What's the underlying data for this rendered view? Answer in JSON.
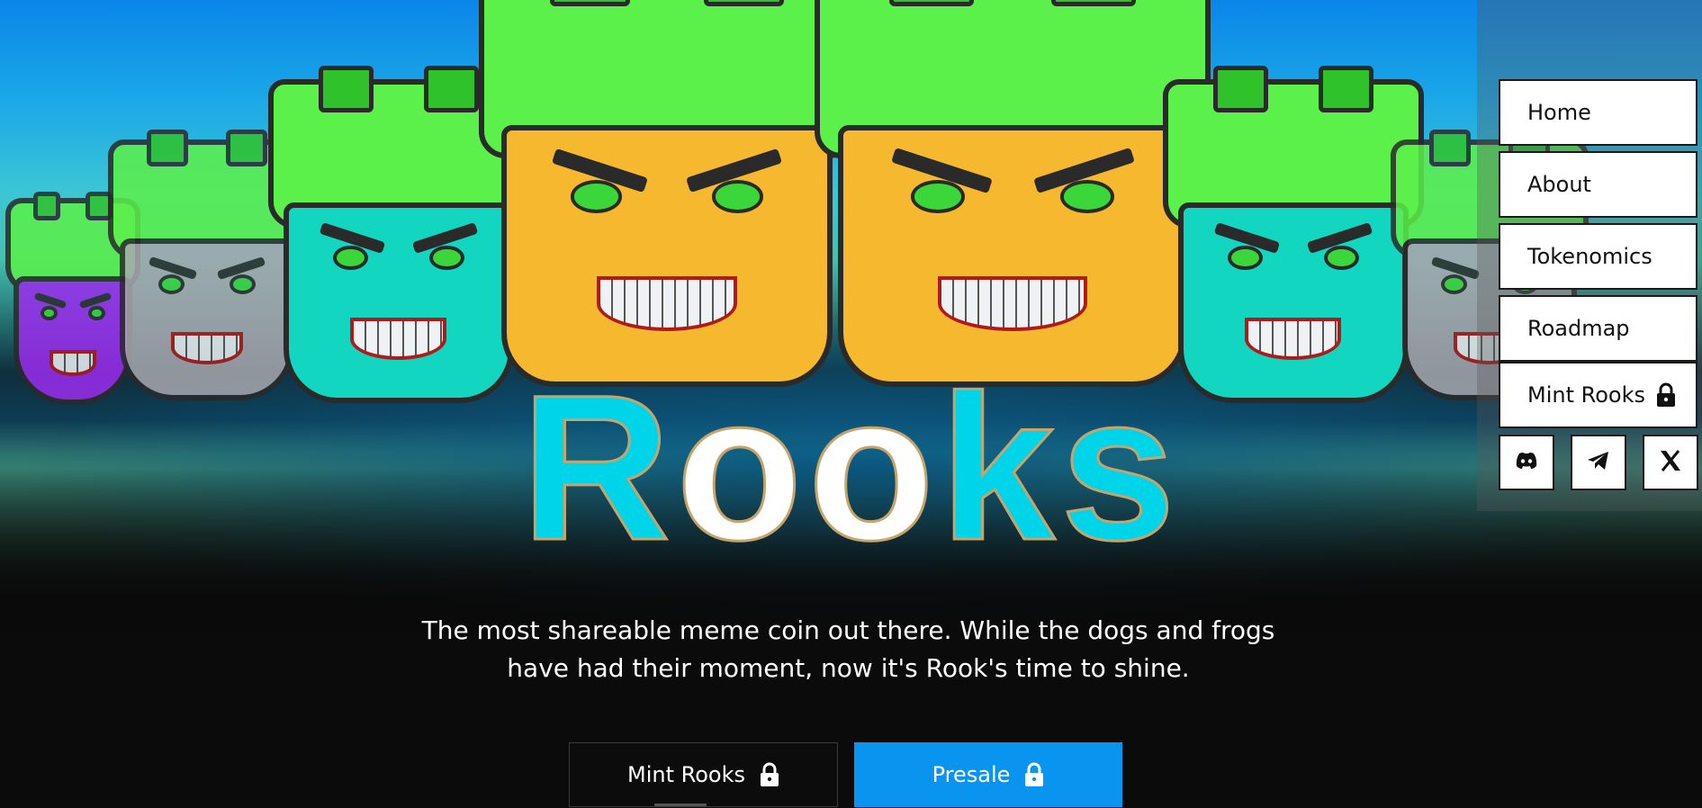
{
  "hero": {
    "title_parts": [
      "R",
      "oo",
      "k",
      "s"
    ],
    "tagline_line1": "The most shareable meme coin out there. While the dogs and frogs",
    "tagline_line2": "have had their moment, now it's Rook's time to shine."
  },
  "cta": {
    "mint_label": "Mint Rooks",
    "presale_label": "Presale"
  },
  "nav": {
    "items": [
      {
        "label": "Home"
      },
      {
        "label": "About"
      },
      {
        "label": "Tokenomics"
      },
      {
        "label": "Roadmap"
      },
      {
        "label": "Mint Rooks",
        "locked": true
      }
    ],
    "social": [
      "discord-icon",
      "telegram-icon",
      "x-icon"
    ]
  },
  "colors": {
    "accent_cyan": "#00d4e8",
    "presale_blue": "#0994f0",
    "rook_green": "#5cf04a",
    "rook_orange": "#f6b82e",
    "rook_teal": "#13d6c1",
    "rook_gray": "#a8a8ae",
    "rook_purple": "#9b2cf0"
  }
}
